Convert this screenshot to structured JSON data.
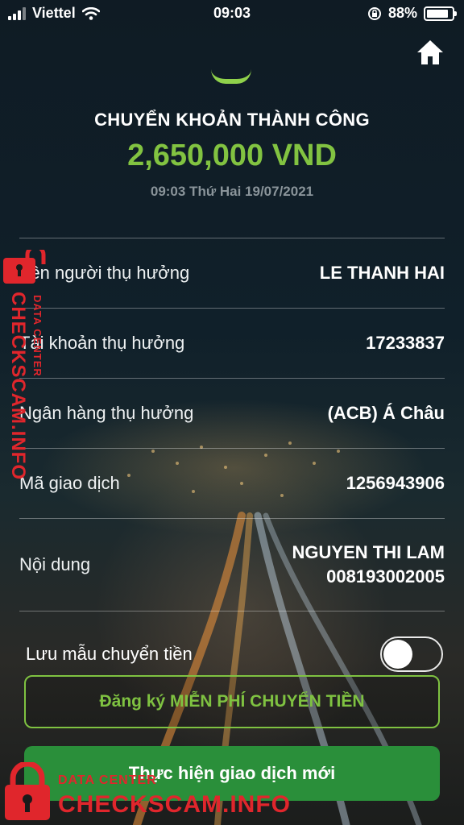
{
  "status_bar": {
    "carrier": "Viettel",
    "time": "09:03",
    "battery_percent": "88%",
    "battery_level": 0.88,
    "icons": [
      "signal-icon",
      "wifi-icon",
      "orientation-lock-icon",
      "battery-icon"
    ]
  },
  "header": {
    "home_icon": "home-icon",
    "title": "CHUYỂN KHOẢN THÀNH CÔNG",
    "amount": "2,650,000 VND",
    "datetime": "09:03 Thứ Hai 19/07/2021"
  },
  "details": [
    {
      "label": "Tên người thụ hưởng",
      "value": "LE THANH HAI"
    },
    {
      "label": "Tài khoản thụ hưởng",
      "value": "17233837"
    },
    {
      "label": "Ngân hàng thụ hưởng",
      "value": "(ACB) Á Châu"
    },
    {
      "label": "Mã giao dịch",
      "value": "1256943906"
    },
    {
      "label": "Nội dung",
      "value_line1": "NGUYEN THI LAM",
      "value_line2": "008193002005"
    }
  ],
  "save_template": {
    "label": "Lưu mẫu chuyển tiền",
    "enabled": false
  },
  "buttons": {
    "register": "Đăng ký MIỄN PHÍ CHUYỂN TIỀN",
    "new_transaction": "Thực hiện giao dịch mới"
  },
  "watermark": {
    "main": "CHECKSCAM.INFO",
    "sub": "DATA CENTER"
  },
  "colors": {
    "accent_green": "#82c341",
    "button_green": "#2a8f3a",
    "watermark_red": "#e0262c"
  }
}
